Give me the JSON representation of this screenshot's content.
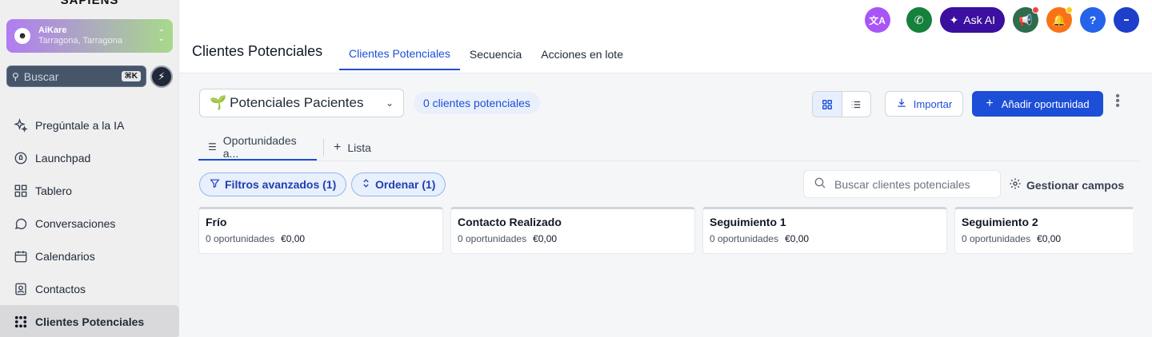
{
  "sidebar": {
    "brand": "SAPIENS",
    "account": {
      "name": "AiKare",
      "location": "Tarragona, Tarragona"
    },
    "search": {
      "placeholder": "Buscar",
      "shortcut": "⌘K"
    },
    "items": [
      {
        "label": "Pregúntale a la IA",
        "icon": "sparkle-icon"
      },
      {
        "label": "Launchpad",
        "icon": "rocket-icon"
      },
      {
        "label": "Tablero",
        "icon": "dashboard-icon"
      },
      {
        "label": "Conversaciones",
        "icon": "chat-icon"
      },
      {
        "label": "Calendarios",
        "icon": "calendar-icon"
      },
      {
        "label": "Contactos",
        "icon": "contacts-icon"
      },
      {
        "label": "Clientes Potenciales",
        "icon": "pipeline-icon",
        "active": true
      }
    ]
  },
  "header": {
    "title": "Clientes Potenciales",
    "tabs": [
      {
        "label": "Clientes Potenciales",
        "active": true
      },
      {
        "label": "Secuencia"
      },
      {
        "label": "Acciones en lote"
      }
    ],
    "ask_ai": "Ask AI",
    "colors": {
      "translate": "#a855f7",
      "phone": "#16803d",
      "announce": "#2f6b4f",
      "bell": "#f97316",
      "help": "#2563eb",
      "avatar": "#1d3fc9"
    }
  },
  "toolbar": {
    "pipeline": "Potenciales Pacientes",
    "count": "0 clientes potenciales",
    "import": "Importar",
    "add": "Añadir oportunidad"
  },
  "subtabs": {
    "current": "Oportunidades a...",
    "add_list": "Lista"
  },
  "filters": {
    "advanced": "Filtros avanzados (1)",
    "sort": "Ordenar (1)",
    "search_placeholder": "Buscar clientes potenciales",
    "manage": "Gestionar campos"
  },
  "stages": [
    {
      "name": "Frío",
      "count": "0 oportunidades",
      "amount": "€0,00"
    },
    {
      "name": "Contacto Realizado",
      "count": "0 oportunidades",
      "amount": "€0,00"
    },
    {
      "name": "Seguimiento 1",
      "count": "0 oportunidades",
      "amount": "€0,00"
    },
    {
      "name": "Seguimiento 2",
      "count": "0 oportunidades",
      "amount": "€0,00"
    }
  ]
}
